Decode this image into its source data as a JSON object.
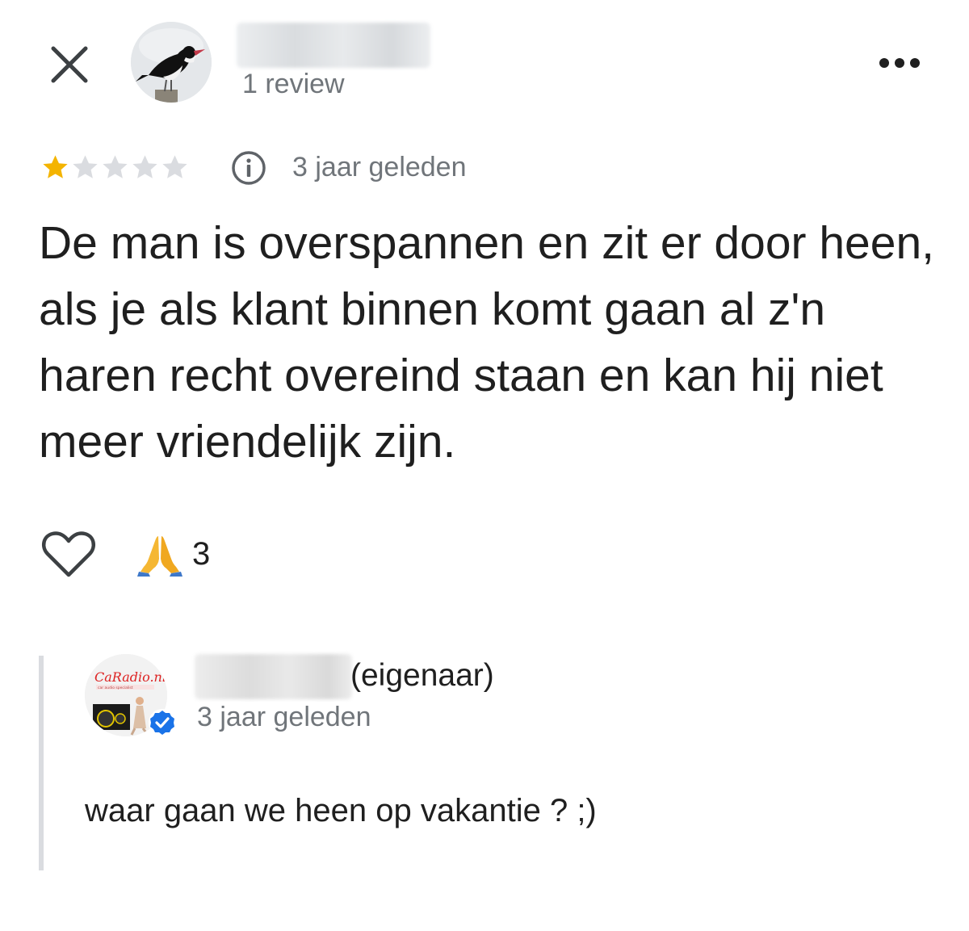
{
  "header": {
    "close_icon": "close-icon",
    "reviewer": {
      "avatar_icon": "bird-avatar",
      "review_count": "1 review"
    },
    "more_icon": "more-horizontal-icon"
  },
  "review": {
    "rating": 1,
    "rating_max": 5,
    "star_color": "#f4b400",
    "star_empty_color": "#dadce0",
    "info_icon": "info-icon",
    "date": "3 jaar geleden",
    "text": "De man is overspannen en zit er door heen, als je als klant binnen komt gaan al z'n haren recht overeind staan en kan hij niet meer vriendelijk zijn."
  },
  "reactions": {
    "like_icon": "heart-outline-icon",
    "emoji_icon": "folded-hands-emoji",
    "count": "3"
  },
  "owner_reply": {
    "avatar_logo_text": "CaRadio.nl",
    "avatar_logo_subtext": "car audio specialist",
    "verified_icon": "verified-badge-icon",
    "role": "(eigenaar)",
    "date": "3 jaar geleden",
    "text": "waar gaan we heen op vakantie ? ;)"
  }
}
